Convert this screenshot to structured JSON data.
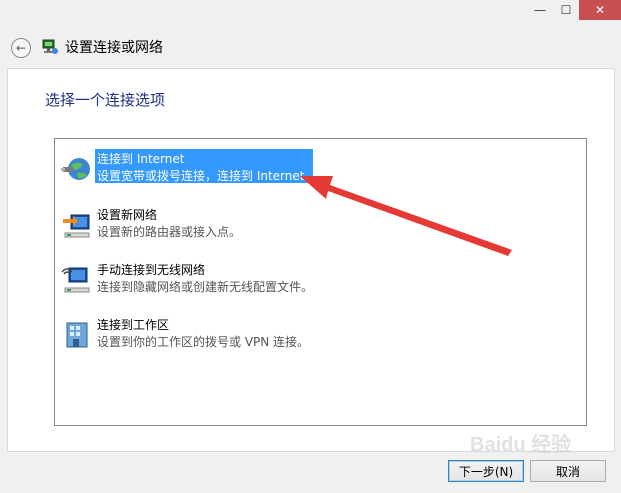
{
  "window": {
    "title": "设置连接或网络",
    "min_label": "—",
    "max_label": "☐",
    "close_label": "✕",
    "back_label": "←",
    "close_color": "#c74f4f"
  },
  "heading": "选择一个连接选项",
  "options": [
    {
      "title": "连接到 Internet",
      "desc": "设置宽带或拨号连接，连接到 Internet。",
      "icon": "globe-network-icon",
      "selected": true
    },
    {
      "title": "设置新网络",
      "desc": "设置新的路由器或接入点。",
      "icon": "new-network-icon",
      "selected": false
    },
    {
      "title": "手动连接到无线网络",
      "desc": "连接到隐藏网络或创建新无线配置文件。",
      "icon": "wireless-network-icon",
      "selected": false
    },
    {
      "title": "连接到工作区",
      "desc": "设置到你的工作区的拨号或 VPN 连接。",
      "icon": "workplace-vpn-icon",
      "selected": false
    }
  ],
  "buttons": {
    "next": "下一步(N)",
    "cancel": "取消"
  },
  "annotation": {
    "color": "#e53935",
    "icon": "red-arrow-annotation"
  },
  "watermark": "Baidu 经验",
  "colors": {
    "accent": "#3399ff",
    "heading": "#1e3287"
  }
}
